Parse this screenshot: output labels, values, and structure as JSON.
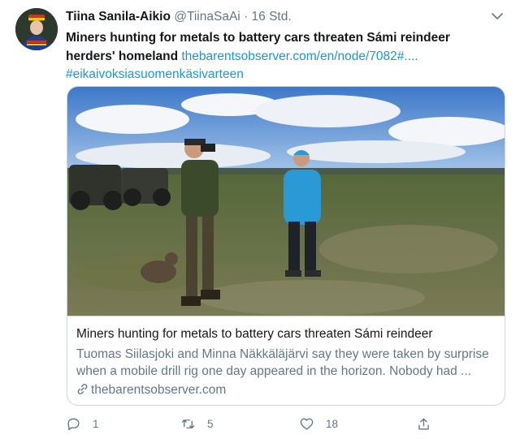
{
  "author": {
    "name": "Tiina Sanila-Aikio",
    "handle": "@TiinaSaAi",
    "separator": "·",
    "time": "16 Std."
  },
  "tweet": {
    "text_bold": "Miners hunting for metals to battery cars threaten Sámi reindeer herders' homeland",
    "link": "thebarentsobserver.com/en/node/7082#....",
    "hashtag": "#eikaivoksiasuomenkäsivarteen"
  },
  "card": {
    "title": "Miners hunting for metals to battery cars threaten Sámi reindeer",
    "description": "Tuomas Siilasjoki and Minna Näkkäläjärvi say they were taken by surprise when a mobile drill rig one day appeared in the horizon. Nobody had ...",
    "domain": "thebarentsobserver.com"
  },
  "actions": {
    "reply_count": "1",
    "retweet_count": "5",
    "like_count": "18"
  },
  "colors": {
    "link": "#1b95e0",
    "secondary": "#657786",
    "border": "#ccd6dd"
  },
  "icons": [
    "chevron-down-icon",
    "link-icon",
    "reply-icon",
    "retweet-icon",
    "like-icon",
    "share-icon"
  ]
}
